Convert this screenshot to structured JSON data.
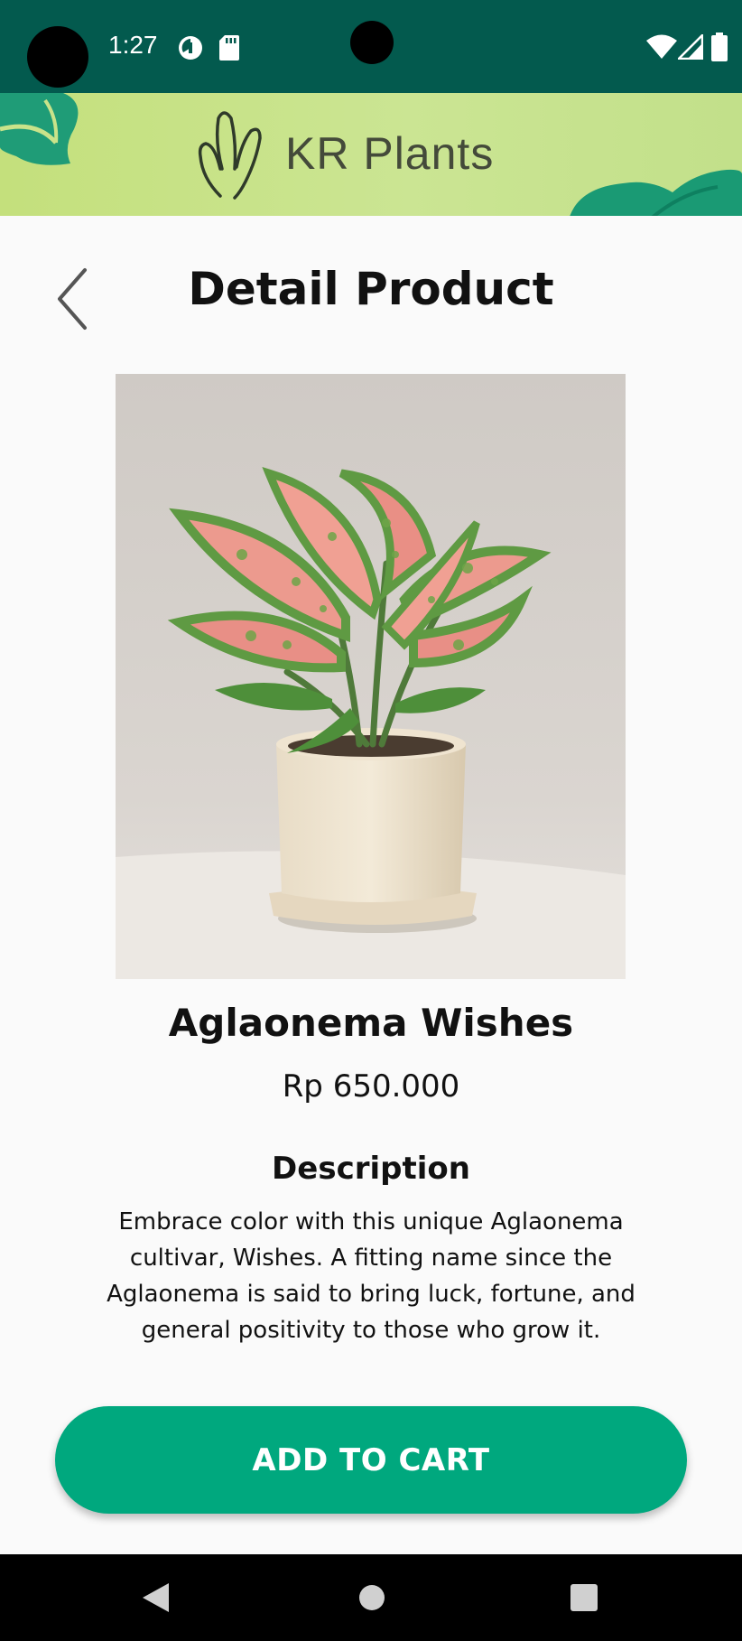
{
  "status_bar": {
    "time": "1:27",
    "icons": [
      "data-saver-icon",
      "sd-card-icon",
      "wifi-icon",
      "signal-icon",
      "battery-icon"
    ]
  },
  "banner": {
    "brand": "KR Plants",
    "logo_icon": "hand-leaf-logo-icon"
  },
  "header": {
    "title": "Detail Product",
    "back_icon": "chevron-left-icon"
  },
  "product": {
    "name": "Aglaonema Wishes",
    "price": "Rp 650.000",
    "image": "aglaonema-plant-in-cream-pot"
  },
  "description": {
    "heading": "Description",
    "text": "Embrace color with this unique Aglaonema cultivar, Wishes. A fitting name since the Aglaonema is said to bring luck, fortune, and general positivity to those who grow it."
  },
  "actions": {
    "add_to_cart": "ADD TO CART"
  },
  "colors": {
    "status_bar": "#035a4e",
    "accent": "#00a87e",
    "banner": "#c8e285",
    "background": "#fafafa"
  },
  "nav_bar": {
    "icons": [
      "back-triangle-icon",
      "home-circle-icon",
      "recents-square-icon"
    ]
  }
}
